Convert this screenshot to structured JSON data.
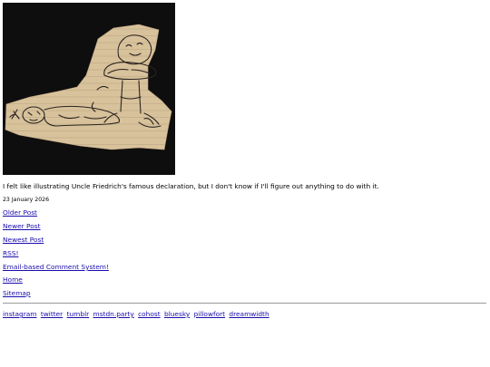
{
  "post": {
    "image_alt": "drawing on lined paper scrap: a reclining figure with a face and a mushroom-shaped figure",
    "text": "I felt like illustrating Uncle Friedrich's famous declaration, but I don't know if I'll figure out anything to do with it.",
    "date": "23 January 2026"
  },
  "nav": {
    "older": "Older Post",
    "newer": "Newer Post",
    "newest": "Newest Post",
    "rss": "RSS!",
    "comments": "Email-based Comment System!",
    "home": "Home",
    "sitemap": "Sitemap"
  },
  "social": [
    "instagram",
    "twitter",
    "tumblr",
    "mstdn.party",
    "cohost",
    "bluesky",
    "pillowfort",
    "dreamwidth"
  ],
  "colors": {
    "link": "#1a0dab",
    "image_bg": "#0f0e0e",
    "paper": "#d9c39e"
  }
}
